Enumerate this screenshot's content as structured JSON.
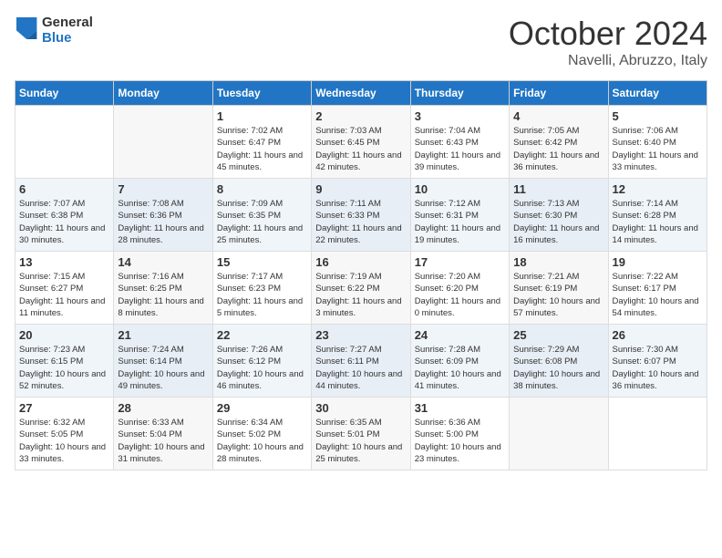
{
  "header": {
    "logo_line1": "General",
    "logo_line2": "Blue",
    "month_title": "October 2024",
    "location": "Navelli, Abruzzo, Italy"
  },
  "weekdays": [
    "Sunday",
    "Monday",
    "Tuesday",
    "Wednesday",
    "Thursday",
    "Friday",
    "Saturday"
  ],
  "rows": [
    [
      {
        "day": "",
        "info": ""
      },
      {
        "day": "",
        "info": ""
      },
      {
        "day": "1",
        "info": "Sunrise: 7:02 AM\nSunset: 6:47 PM\nDaylight: 11 hours and 45 minutes."
      },
      {
        "day": "2",
        "info": "Sunrise: 7:03 AM\nSunset: 6:45 PM\nDaylight: 11 hours and 42 minutes."
      },
      {
        "day": "3",
        "info": "Sunrise: 7:04 AM\nSunset: 6:43 PM\nDaylight: 11 hours and 39 minutes."
      },
      {
        "day": "4",
        "info": "Sunrise: 7:05 AM\nSunset: 6:42 PM\nDaylight: 11 hours and 36 minutes."
      },
      {
        "day": "5",
        "info": "Sunrise: 7:06 AM\nSunset: 6:40 PM\nDaylight: 11 hours and 33 minutes."
      }
    ],
    [
      {
        "day": "6",
        "info": "Sunrise: 7:07 AM\nSunset: 6:38 PM\nDaylight: 11 hours and 30 minutes."
      },
      {
        "day": "7",
        "info": "Sunrise: 7:08 AM\nSunset: 6:36 PM\nDaylight: 11 hours and 28 minutes."
      },
      {
        "day": "8",
        "info": "Sunrise: 7:09 AM\nSunset: 6:35 PM\nDaylight: 11 hours and 25 minutes."
      },
      {
        "day": "9",
        "info": "Sunrise: 7:11 AM\nSunset: 6:33 PM\nDaylight: 11 hours and 22 minutes."
      },
      {
        "day": "10",
        "info": "Sunrise: 7:12 AM\nSunset: 6:31 PM\nDaylight: 11 hours and 19 minutes."
      },
      {
        "day": "11",
        "info": "Sunrise: 7:13 AM\nSunset: 6:30 PM\nDaylight: 11 hours and 16 minutes."
      },
      {
        "day": "12",
        "info": "Sunrise: 7:14 AM\nSunset: 6:28 PM\nDaylight: 11 hours and 14 minutes."
      }
    ],
    [
      {
        "day": "13",
        "info": "Sunrise: 7:15 AM\nSunset: 6:27 PM\nDaylight: 11 hours and 11 minutes."
      },
      {
        "day": "14",
        "info": "Sunrise: 7:16 AM\nSunset: 6:25 PM\nDaylight: 11 hours and 8 minutes."
      },
      {
        "day": "15",
        "info": "Sunrise: 7:17 AM\nSunset: 6:23 PM\nDaylight: 11 hours and 5 minutes."
      },
      {
        "day": "16",
        "info": "Sunrise: 7:19 AM\nSunset: 6:22 PM\nDaylight: 11 hours and 3 minutes."
      },
      {
        "day": "17",
        "info": "Sunrise: 7:20 AM\nSunset: 6:20 PM\nDaylight: 11 hours and 0 minutes."
      },
      {
        "day": "18",
        "info": "Sunrise: 7:21 AM\nSunset: 6:19 PM\nDaylight: 10 hours and 57 minutes."
      },
      {
        "day": "19",
        "info": "Sunrise: 7:22 AM\nSunset: 6:17 PM\nDaylight: 10 hours and 54 minutes."
      }
    ],
    [
      {
        "day": "20",
        "info": "Sunrise: 7:23 AM\nSunset: 6:15 PM\nDaylight: 10 hours and 52 minutes."
      },
      {
        "day": "21",
        "info": "Sunrise: 7:24 AM\nSunset: 6:14 PM\nDaylight: 10 hours and 49 minutes."
      },
      {
        "day": "22",
        "info": "Sunrise: 7:26 AM\nSunset: 6:12 PM\nDaylight: 10 hours and 46 minutes."
      },
      {
        "day": "23",
        "info": "Sunrise: 7:27 AM\nSunset: 6:11 PM\nDaylight: 10 hours and 44 minutes."
      },
      {
        "day": "24",
        "info": "Sunrise: 7:28 AM\nSunset: 6:09 PM\nDaylight: 10 hours and 41 minutes."
      },
      {
        "day": "25",
        "info": "Sunrise: 7:29 AM\nSunset: 6:08 PM\nDaylight: 10 hours and 38 minutes."
      },
      {
        "day": "26",
        "info": "Sunrise: 7:30 AM\nSunset: 6:07 PM\nDaylight: 10 hours and 36 minutes."
      }
    ],
    [
      {
        "day": "27",
        "info": "Sunrise: 6:32 AM\nSunset: 5:05 PM\nDaylight: 10 hours and 33 minutes."
      },
      {
        "day": "28",
        "info": "Sunrise: 6:33 AM\nSunset: 5:04 PM\nDaylight: 10 hours and 31 minutes."
      },
      {
        "day": "29",
        "info": "Sunrise: 6:34 AM\nSunset: 5:02 PM\nDaylight: 10 hours and 28 minutes."
      },
      {
        "day": "30",
        "info": "Sunrise: 6:35 AM\nSunset: 5:01 PM\nDaylight: 10 hours and 25 minutes."
      },
      {
        "day": "31",
        "info": "Sunrise: 6:36 AM\nSunset: 5:00 PM\nDaylight: 10 hours and 23 minutes."
      },
      {
        "day": "",
        "info": ""
      },
      {
        "day": "",
        "info": ""
      }
    ]
  ]
}
